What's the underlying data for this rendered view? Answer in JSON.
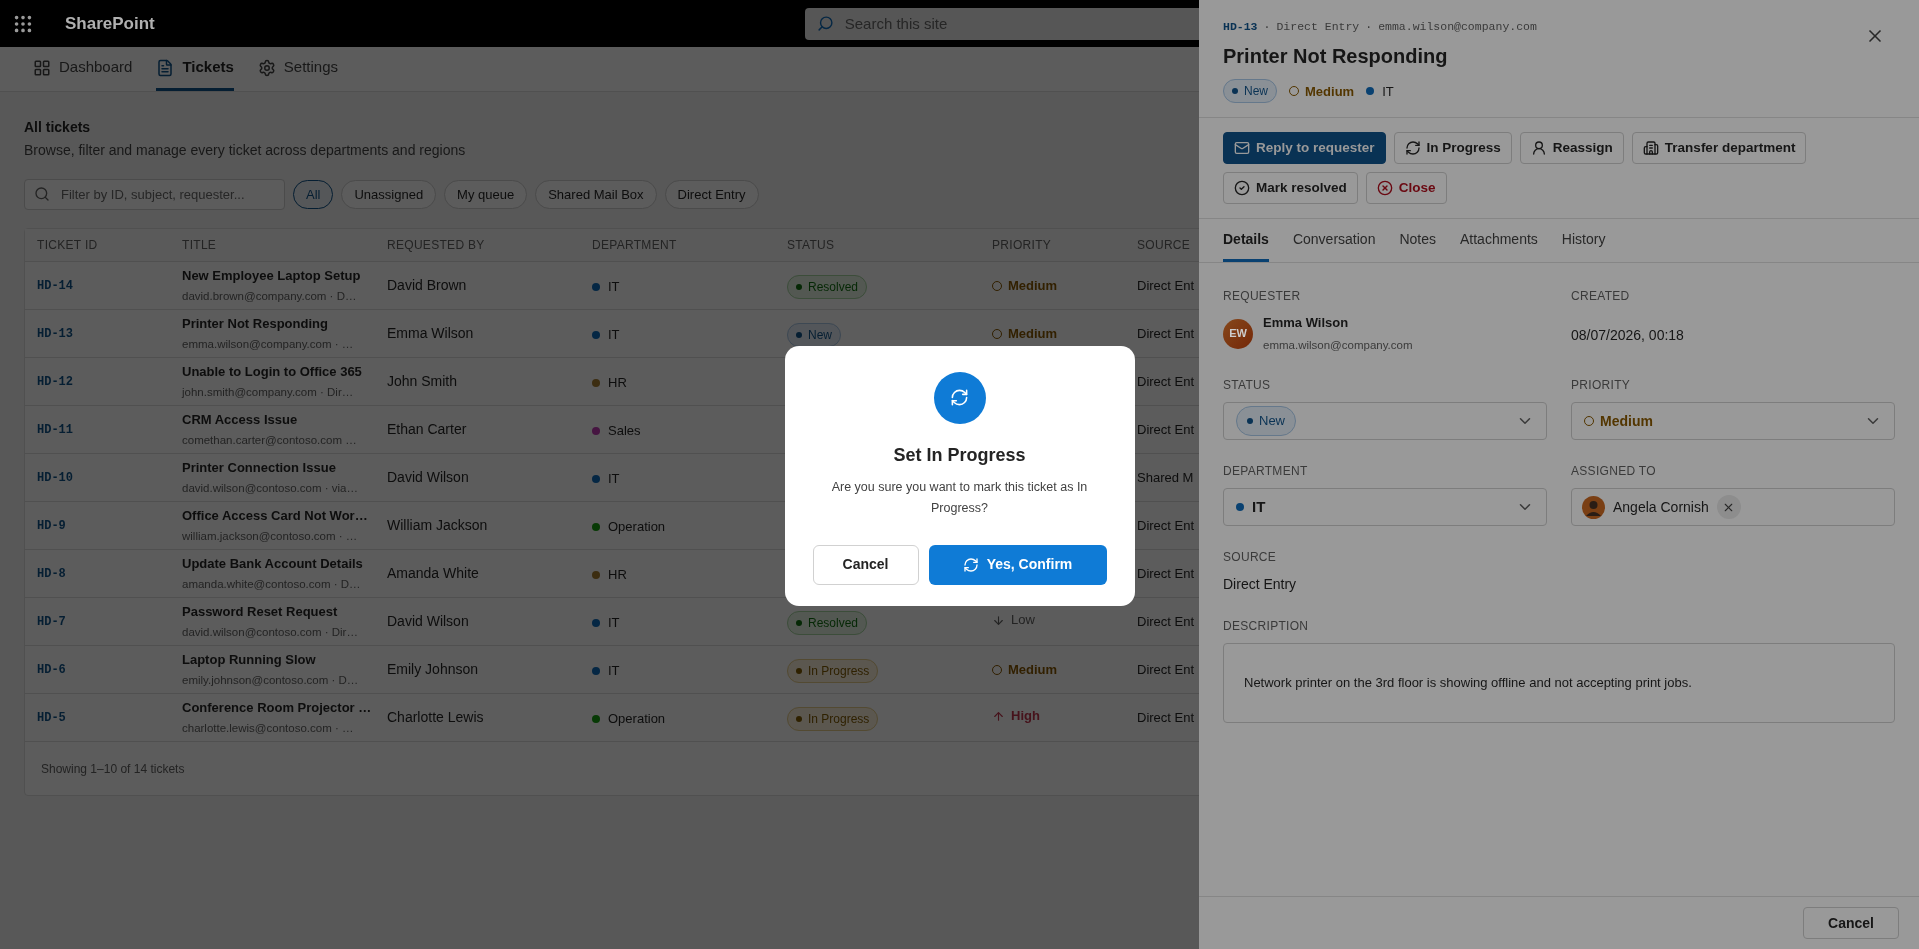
{
  "topbar": {
    "app_name": "SharePoint",
    "search": {
      "placeholder": "Search this site"
    }
  },
  "nav_tabs": [
    {
      "label": "Dashboard",
      "selected": false
    },
    {
      "label": "Tickets",
      "selected": true
    },
    {
      "label": "Settings",
      "selected": false
    }
  ],
  "page": {
    "title": "All tickets",
    "subtitle": "Browse, filter and manage every ticket across departments and regions"
  },
  "filters": {
    "search": {
      "placeholder": "Filter by ID, subject, requester..."
    },
    "chips": [
      {
        "label": "All",
        "selected": true
      },
      {
        "label": "Unassigned",
        "selected": false
      },
      {
        "label": "My queue",
        "selected": false
      },
      {
        "label": "Shared Mail Box",
        "selected": false
      },
      {
        "label": "Direct Entry",
        "selected": false
      }
    ]
  },
  "table": {
    "columns": [
      "TICKET ID",
      "TITLE",
      "REQUESTED BY",
      "DEPARTMENT",
      "STATUS",
      "PRIORITY",
      "SOURCE"
    ],
    "rows": [
      {
        "id": "HD-14",
        "title": "New Employee Laptop Setup",
        "subtitle": "david.brown@company.com · D…",
        "requester": "David Brown",
        "department": {
          "label": "IT",
          "color": "#052744"
        },
        "status": {
          "label": "Resolved",
          "kind": "resolved"
        },
        "priority": {
          "label": "Medium",
          "kind": "medium"
        },
        "source": "Direct Ent"
      },
      {
        "id": "HD-13",
        "title": "Printer Not Responding",
        "subtitle": "emma.wilson@company.com · …",
        "requester": "Emma Wilson",
        "department": {
          "label": "IT",
          "color": "#052744"
        },
        "status": {
          "label": "New",
          "kind": "new"
        },
        "priority": {
          "label": "Medium",
          "kind": "medium"
        },
        "source": "Direct Ent"
      },
      {
        "id": "HD-12",
        "title": "Unable to Login to Office 365",
        "subtitle": "john.smith@company.com · Dir…",
        "requester": "John Smith",
        "department": {
          "label": "HR",
          "color": "#3c2d11"
        },
        "source": "Direct Ent"
      },
      {
        "id": "HD-11",
        "title": "CRM Access Issue",
        "subtitle": "comethan.carter@contoso.com …",
        "requester": "Ethan Carter",
        "department": {
          "label": "Sales",
          "color": "#461541"
        },
        "source": "Direct Ent"
      },
      {
        "id": "HD-10",
        "title": "Printer Connection Issue",
        "subtitle": "david.wilson@contoso.com · via…",
        "requester": "David Wilson",
        "department": {
          "label": "IT",
          "color": "#052744"
        },
        "source": "Shared M"
      },
      {
        "id": "HD-9",
        "title": "Office Access Card Not Wor…",
        "subtitle": "william.jackson@contoso.com · …",
        "requester": "William Jackson",
        "department": {
          "label": "Operation",
          "color": "#073a05"
        },
        "source": "Direct Ent"
      },
      {
        "id": "HD-8",
        "title": "Update Bank Account Details",
        "subtitle": "amanda.white@contoso.com · D…",
        "requester": "Amanda White",
        "department": {
          "label": "HR",
          "color": "#3c2d11"
        },
        "source": "Direct Ent"
      },
      {
        "id": "HD-7",
        "title": "Password Reset Request",
        "subtitle": "david.wilson@contoso.com · Dir…",
        "requester": "David Wilson",
        "department": {
          "label": "IT",
          "color": "#052744"
        },
        "status": {
          "label": "Resolved",
          "kind": "resolved"
        },
        "priority": {
          "label": "Low",
          "kind": "low"
        },
        "source": "Direct Ent"
      },
      {
        "id": "HD-6",
        "title": "Laptop Running Slow",
        "subtitle": "emily.johnson@contoso.com · D…",
        "requester": "Emily Johnson",
        "department": {
          "label": "IT",
          "color": "#052744"
        },
        "status": {
          "label": "In Progress",
          "kind": "in_progress"
        },
        "priority": {
          "label": "Medium",
          "kind": "medium"
        },
        "source": "Direct Ent"
      },
      {
        "id": "HD-5",
        "title": "Conference Room Projector …",
        "subtitle": "charlotte.lewis@contoso.com · …",
        "requester": "Charlotte Lewis",
        "department": {
          "label": "Operation",
          "color": "#073a05"
        },
        "status": {
          "label": "In Progress",
          "kind": "in_progress"
        },
        "priority": {
          "label": "High",
          "kind": "high"
        },
        "source": "Direct Ent"
      }
    ],
    "footer": "Showing 1–10 of 14 tickets"
  },
  "drawer": {
    "ticket_id": "HD-13",
    "separator": "·",
    "source": "Direct Entry",
    "email": "emma.wilson@company.com",
    "title": "Printer Not Responding",
    "status": {
      "label": "New",
      "kind": "new"
    },
    "priority": {
      "label": "Medium",
      "kind": "medium"
    },
    "department": {
      "label": "IT",
      "color": "#094171"
    },
    "actions": [
      {
        "label": "Reply to requester",
        "kind": "primary"
      },
      {
        "label": "In Progress",
        "kind": "default"
      },
      {
        "label": "Reassign",
        "kind": "default"
      },
      {
        "label": "Transfer department",
        "kind": "default"
      },
      {
        "label": "Mark resolved",
        "kind": "default"
      },
      {
        "label": "Close",
        "kind": "danger"
      }
    ],
    "tabs": [
      {
        "label": "Details",
        "selected": true
      },
      {
        "label": "Conversation",
        "selected": false
      },
      {
        "label": "Notes",
        "selected": false
      },
      {
        "label": "Attachments",
        "selected": false
      },
      {
        "label": "History",
        "selected": false
      }
    ],
    "requester": {
      "label": "REQUESTER",
      "initials": "EW",
      "name": "Emma Wilson",
      "email": "emma.wilson@company.com"
    },
    "created": {
      "label": "CREATED",
      "value": "08/07/2026, 00:18"
    },
    "status_field": {
      "label": "STATUS",
      "value": {
        "label": "New",
        "kind": "new"
      }
    },
    "priority_field": {
      "label": "PRIORITY",
      "value": {
        "label": "Medium",
        "kind": "medium"
      }
    },
    "department_field": {
      "label": "DEPARTMENT",
      "value": {
        "label": "IT",
        "color": "#094171"
      }
    },
    "assigned_field": {
      "label": "ASSIGNED TO",
      "name": "Angela Cornish"
    },
    "source_field": {
      "label": "SOURCE",
      "value": "Direct Entry"
    },
    "description_field": {
      "label": "DESCRIPTION",
      "value": "Network printer on the 3rd floor is showing offline and not accepting print jobs."
    },
    "cancel_button": "Cancel"
  },
  "modal": {
    "title": "Set In Progress",
    "message": "Are you sure you want to mark this ticket as In Progress?",
    "buttons": [
      {
        "label": "Cancel",
        "kind": "secondary"
      },
      {
        "label": "Yes, Confirm",
        "kind": "primary"
      }
    ]
  }
}
